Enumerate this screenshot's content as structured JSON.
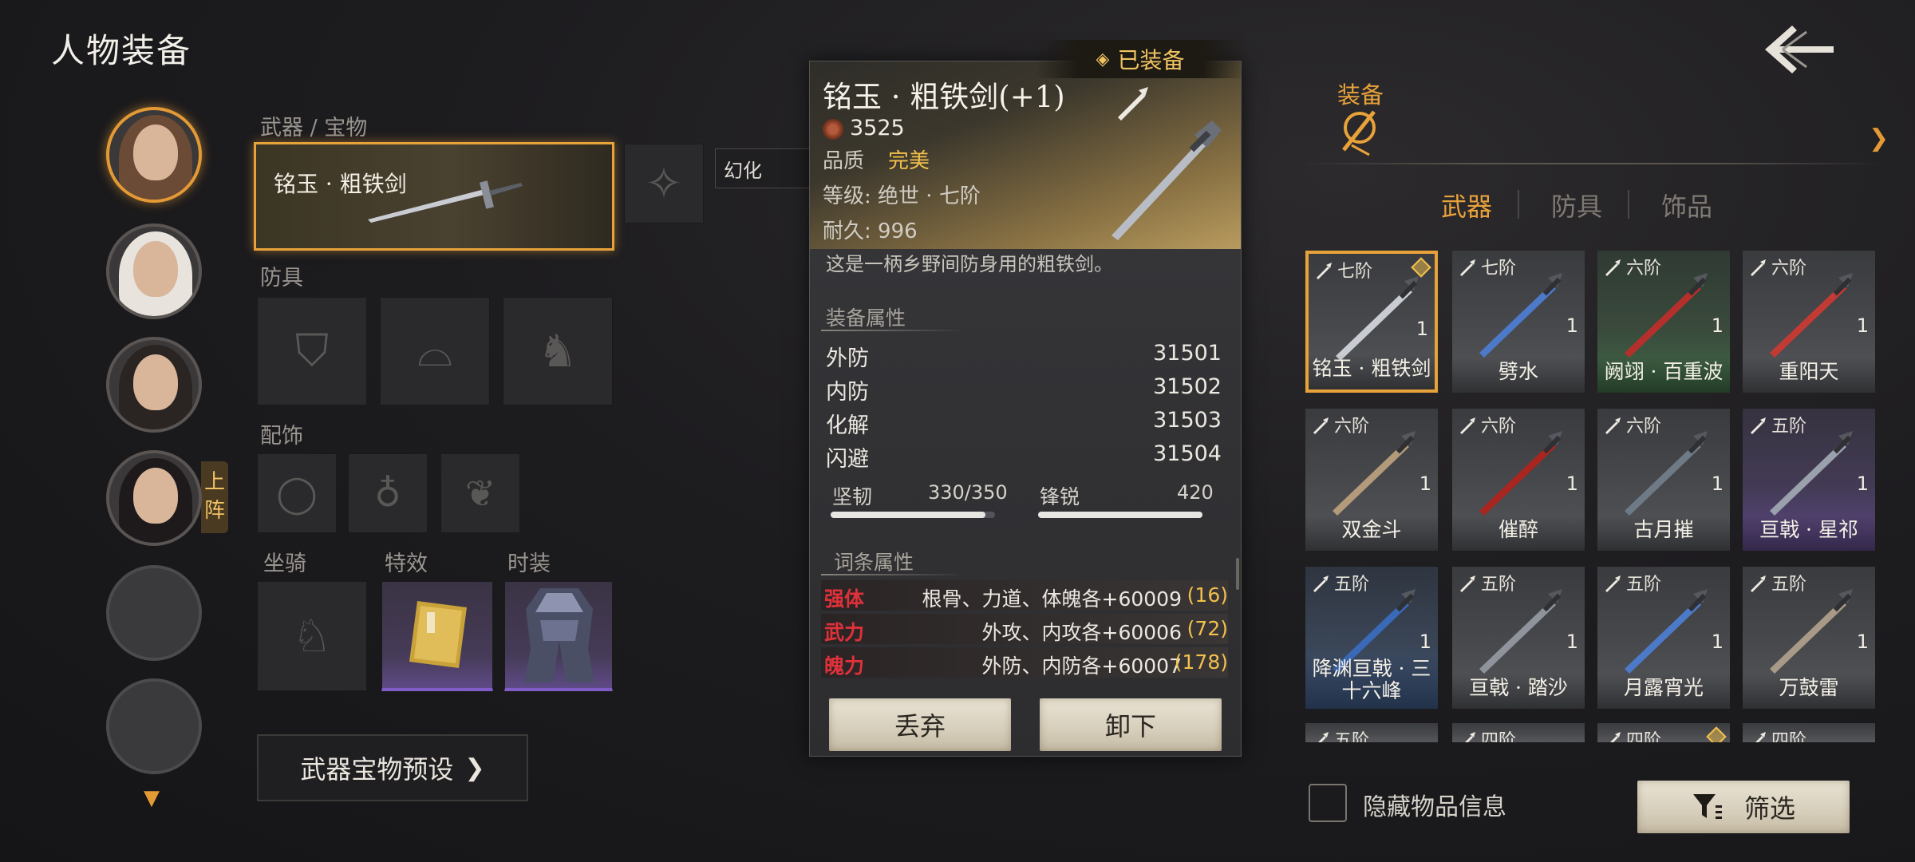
{
  "page": {
    "title": "人物装备"
  },
  "characters": {
    "deploy_label": "上阵",
    "items": [
      {
        "state": "selected",
        "name": "character-1"
      },
      {
        "state": "normal",
        "name": "character-2"
      },
      {
        "state": "normal",
        "name": "character-3"
      },
      {
        "state": "normal",
        "name": "character-4"
      },
      {
        "state": "empty",
        "name": "empty-slot-1"
      },
      {
        "state": "empty",
        "name": "empty-slot-2"
      }
    ]
  },
  "equip": {
    "weapon_section": "武器 / 宝物",
    "weapon_name": "铭玉 · 粗铁剑",
    "phantom_label": "幻化",
    "armor_section": "防具",
    "accessory_section": "配饰",
    "mount_section": "坐骑",
    "effect_section": "特效",
    "outfit_section": "时装",
    "preset_label": "武器宝物预设"
  },
  "detail": {
    "equipped_banner": "已装备",
    "name": "铭玉 · 粗铁剑(+1)",
    "power": "3525",
    "quality_label": "品质",
    "quality_value": "完美",
    "grade": "等级: 绝世 · 七阶",
    "durability": "耐久: 996",
    "description": "这是一柄乡野间防身用的粗铁剑。",
    "attr_title": "装备属性",
    "attrs": [
      {
        "k": "外防",
        "v": "31501"
      },
      {
        "k": "内防",
        "v": "31502"
      },
      {
        "k": "化解",
        "v": "31503"
      },
      {
        "k": "闪避",
        "v": "31504"
      }
    ],
    "toughness": {
      "label": "坚韧",
      "value": "330/350",
      "ratio": 0.943
    },
    "sharpness": {
      "label": "锋锐",
      "value": "420",
      "ratio": 1.0
    },
    "affix_title": "词条属性",
    "affixes": [
      {
        "k": "强体",
        "v": "根骨、力道、体魄各+60009",
        "lv": "(16)"
      },
      {
        "k": "武力",
        "v": "外攻、内攻各+60006",
        "lv": "(72)"
      },
      {
        "k": "魄力",
        "v": "外防、内防各+60007",
        "lv": "(178)"
      }
    ],
    "discard_label": "丢弃",
    "unequip_label": "卸下"
  },
  "inventory": {
    "tab_label": "装备",
    "categories": [
      "武器",
      "防具",
      "饰品"
    ],
    "active_category": "武器",
    "items": [
      {
        "tier": "七阶",
        "name": "铭玉 · 粗铁剑",
        "qty": "1",
        "style": "gray",
        "selected": true,
        "equipped": true,
        "blade": "#c9ccd2"
      },
      {
        "tier": "七阶",
        "name": "劈水",
        "qty": "1",
        "style": "gray",
        "blade": "#4c79c8"
      },
      {
        "tier": "六阶",
        "name": "阙翊 · 百重波",
        "qty": "1",
        "style": "green",
        "blade": "#b5302c"
      },
      {
        "tier": "六阶",
        "name": "重阳天",
        "qty": "1",
        "style": "gray",
        "blade": "#c23a34"
      },
      {
        "tier": "六阶",
        "name": "双金斗",
        "qty": "1",
        "style": "gray",
        "blade": "#b39a7a"
      },
      {
        "tier": "六阶",
        "name": "催醉",
        "qty": "1",
        "style": "gray",
        "blade": "#a8261f"
      },
      {
        "tier": "六阶",
        "name": "古月摧",
        "qty": "1",
        "style": "gray",
        "blade": "#6e7a86"
      },
      {
        "tier": "五阶",
        "name": "亘戟 · 星祁",
        "qty": "1",
        "style": "purple",
        "blade": "#9aa0ac"
      },
      {
        "tier": "五阶",
        "name": "降渊亘戟 · 三十六峰",
        "qty": "1",
        "style": "blue",
        "blade": "#3a69b8"
      },
      {
        "tier": "五阶",
        "name": "亘戟 · 踏沙",
        "qty": "1",
        "style": "gray",
        "blade": "#8f949c"
      },
      {
        "tier": "五阶",
        "name": "月露宵光",
        "qty": "1",
        "style": "gray",
        "blade": "#4c79c8"
      },
      {
        "tier": "五阶",
        "name": "万鼓雷",
        "qty": "1",
        "style": "gray",
        "blade": "#a89a86"
      },
      {
        "tier": "五阶",
        "name": "",
        "qty": "",
        "style": "gray",
        "blade": "#777"
      },
      {
        "tier": "四阶",
        "name": "",
        "qty": "",
        "style": "gray",
        "blade": "#777"
      },
      {
        "tier": "四阶",
        "name": "",
        "qty": "",
        "style": "gray",
        "equipped": true,
        "blade": "#777"
      },
      {
        "tier": "四阶",
        "name": "",
        "qty": "",
        "style": "gray",
        "blade": "#777"
      }
    ],
    "hide_info_label": "隐藏物品信息",
    "filter_label": "筛选"
  },
  "colors": {
    "accent": "#e8a23a",
    "gold_text": "#f2c04c",
    "affix_red": "#e0313a"
  }
}
